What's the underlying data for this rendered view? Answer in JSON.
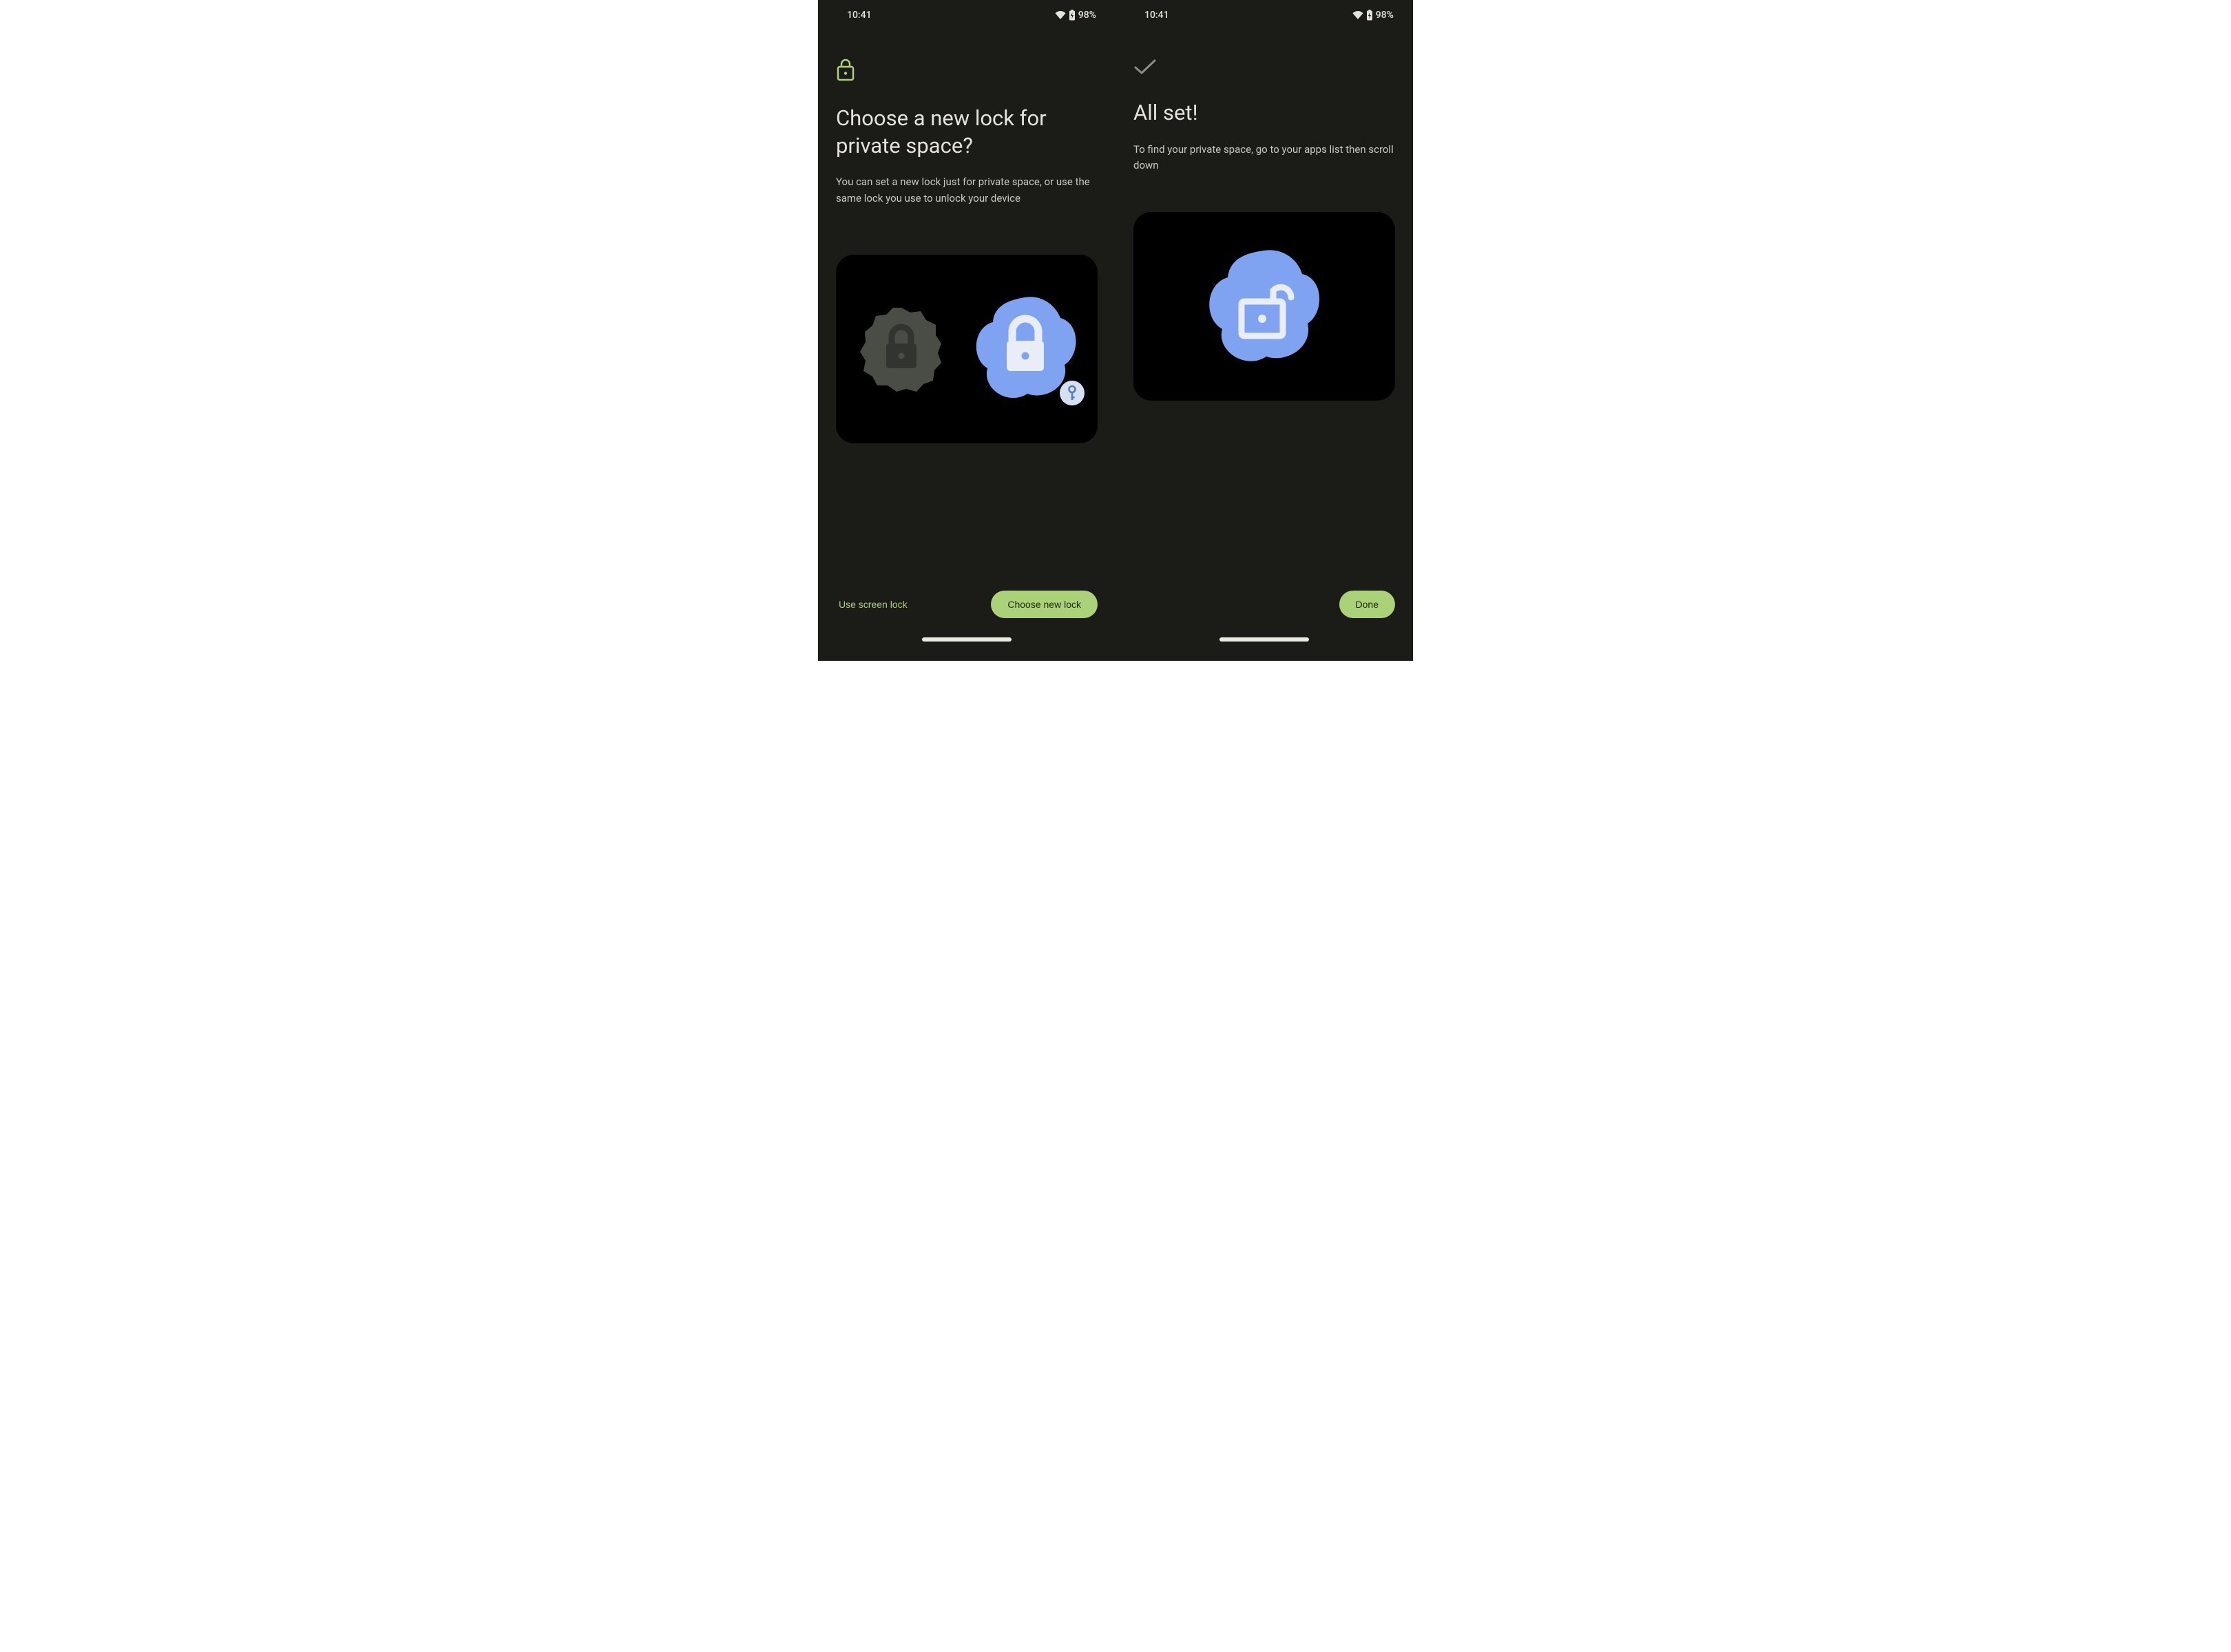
{
  "status": {
    "time": "10:41",
    "battery_text": "98%"
  },
  "screen1": {
    "title": "Choose a new lock for private space?",
    "subtitle": "You can set a new lock just for private space, or use the same lock you use to unlock your device",
    "secondary_button": "Use screen lock",
    "primary_button": "Choose new lock"
  },
  "screen2": {
    "title": "All set!",
    "subtitle": "To find your private space, go to your apps list then scroll down",
    "primary_button": "Done"
  },
  "colors": {
    "accent": "#acd279",
    "blue": "#7fa3f0",
    "bg": "#1b1c17"
  }
}
